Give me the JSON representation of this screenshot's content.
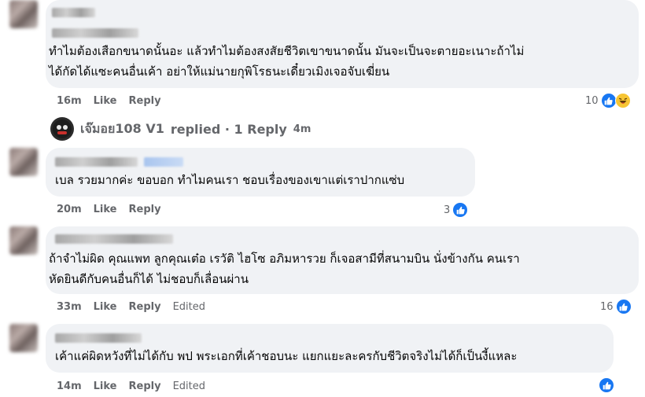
{
  "comments": [
    {
      "text_lines": [
        "ทำไมต้องเสือกขนาดนั้นอะ แล้วทำไมต้องสงสัยชีวิตเขาขนาดนั้น มันจะเป็นจะตายอะเนาะถ้าไม่",
        "ได้กัดได้แซะคนอื่นเค้า อย่าให้แม่นายกุพิโรธนะเดี๋ยวเมิงเจอจับเฆี่ยน"
      ],
      "time": "16m",
      "like_label": "Like",
      "reply_label": "Reply",
      "edited_label": "",
      "reaction_count": "10",
      "reactions": [
        "like-icon",
        "haha-icon"
      ]
    },
    {
      "text_lines": [
        "เบล รวยมากค่ะ ขอบอก ทำไมคนเรา ชอบเรื่องของเขาแต่เราปากแซ่บ"
      ],
      "time": "20m",
      "like_label": "Like",
      "reply_label": "Reply",
      "edited_label": "",
      "reaction_count": "3",
      "reactions": [
        "like-icon"
      ]
    },
    {
      "text_lines": [
        "ถ้าจำไม่ผิด คุณแพท ลูกคุณเต๋อ เรวัติ ไฮโซ อภิมหารวย ก็เจอสามีที่สนามบิน นั่งข้างกัน คนเรา",
        "หัดยินดีกับคนอื่นก็ได้ ไม่ชอบก็เลื่อนผ่าน"
      ],
      "time": "33m",
      "like_label": "Like",
      "reply_label": "Reply",
      "edited_label": "Edited",
      "reaction_count": "16",
      "reactions": [
        "like-icon"
      ]
    },
    {
      "text_lines": [
        "เค้าแค่ผิดหวังที่ไม่ได้กับ พป พระเอกที่เค้าชอบนะ แยกแยะละครกับชีวิตจริงไม่ได้ก็เป็นงี้แหละ"
      ],
      "time": "14m",
      "like_label": "Like",
      "reply_label": "Reply",
      "edited_label": "Edited",
      "reaction_count": "",
      "reactions": [
        "like-icon"
      ]
    }
  ],
  "reply_summary": {
    "author": "เจ๊มอย108 V1",
    "text": "replied · 1 Reply",
    "time": "4m"
  },
  "colors": {
    "bubble": "#f0f2f5",
    "meta_text": "#65676b",
    "like_blue": "#1877f2"
  }
}
